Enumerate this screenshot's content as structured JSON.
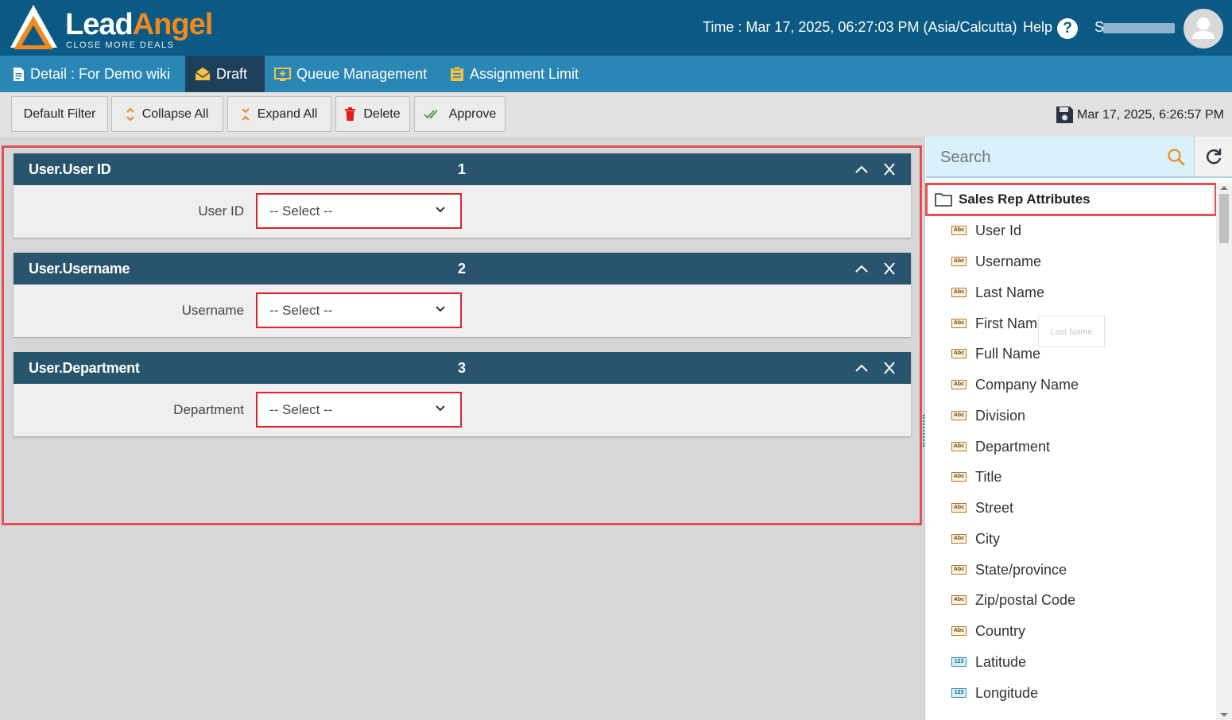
{
  "header": {
    "logo_lead": "Lead",
    "logo_angel": "Angel",
    "logo_tagline": "CLOSE MORE DEALS",
    "time": "Time : Mar 17, 2025, 06:27:03 PM (Asia/Calcutta)",
    "help_label": "Help",
    "help_icon": "?",
    "username": "S"
  },
  "tabs": [
    {
      "label": "Detail : For Demo wiki",
      "icon": "document-icon"
    },
    {
      "label": "Draft",
      "icon": "envelope-open-icon"
    },
    {
      "label": "Queue Management",
      "icon": "queue-add-icon"
    },
    {
      "label": "Assignment Limit",
      "icon": "clipboard-icon"
    }
  ],
  "toolbar": {
    "default_filter": "Default Filter",
    "collapse_all": "Collapse All",
    "expand_all": "Expand All",
    "delete": "Delete",
    "approve": "Approve",
    "saved_time": "Mar 17, 2025, 6:26:57 PM"
  },
  "panels": [
    {
      "title": "User.User ID",
      "number": "1",
      "field_label": "User ID",
      "select_value": "-- Select --"
    },
    {
      "title": "User.Username",
      "number": "2",
      "field_label": "Username",
      "select_value": "-- Select --"
    },
    {
      "title": "User.Department",
      "number": "3",
      "field_label": "Department",
      "select_value": "-- Select --"
    }
  ],
  "sidebar": {
    "search_placeholder": "Search",
    "group_title": "Sales Rep Attributes",
    "tooltip": "Last Name",
    "attributes": [
      {
        "label": "User Id",
        "type": "Abc"
      },
      {
        "label": "Username",
        "type": "Abc"
      },
      {
        "label": "Last Name",
        "type": "Abc"
      },
      {
        "label": "First Name",
        "type": "Abc"
      },
      {
        "label": "Full Name",
        "type": "Abc"
      },
      {
        "label": "Company Name",
        "type": "Abc"
      },
      {
        "label": "Division",
        "type": "Abc"
      },
      {
        "label": "Department",
        "type": "Abc"
      },
      {
        "label": "Title",
        "type": "Abc"
      },
      {
        "label": "Street",
        "type": "Abc"
      },
      {
        "label": "City",
        "type": "Abc"
      },
      {
        "label": "State/province",
        "type": "Abc"
      },
      {
        "label": "Zip/postal Code",
        "type": "Abc"
      },
      {
        "label": "Country",
        "type": "Abc"
      },
      {
        "label": "Latitude",
        "type": "123"
      },
      {
        "label": "Longitude",
        "type": "123"
      }
    ]
  },
  "colors": {
    "header_bg": "#0b5a85",
    "tabbar_bg": "#2a86b4",
    "active_tab_bg": "#1e3f5a",
    "panel_head_bg": "#28546e",
    "brand_orange": "#f08a1c",
    "highlight_red": "#e05252"
  }
}
